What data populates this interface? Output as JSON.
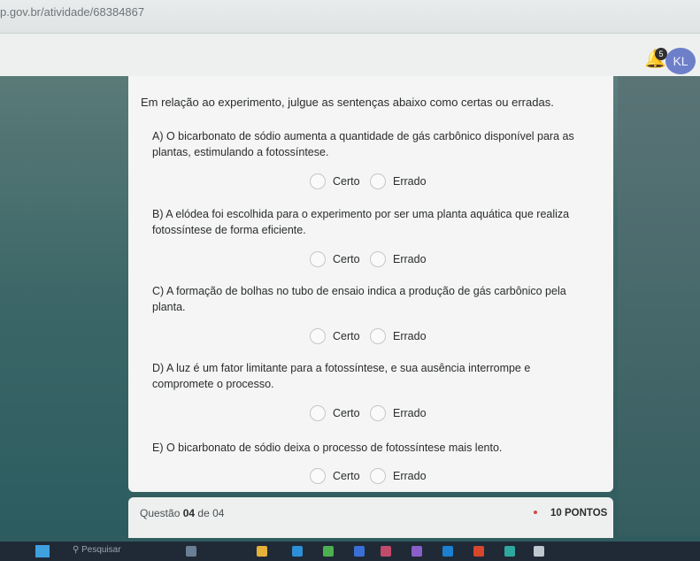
{
  "browser": {
    "url": "p.gov.br/atividade/68384867"
  },
  "header": {
    "notification_count": "5",
    "avatar_initials": "KL"
  },
  "question": {
    "intro": "Em relação ao experimento, julgue as sentenças abaixo como certas ou erradas.",
    "statements": [
      {
        "text": "A) O bicarbonato de sódio aumenta a quantidade de gás carbônico disponível para as plantas, estimulando a fotossíntese.",
        "option_true": "Certo",
        "option_false": "Errado"
      },
      {
        "text": "B) A elódea foi escolhida para o experimento por ser uma planta aquática que realiza fotossíntese de forma eficiente.",
        "option_true": "Certo",
        "option_false": "Errado"
      },
      {
        "text": "C) A formação de bolhas no tubo de ensaio indica a produção de gás carbônico pela planta.",
        "option_true": "Certo",
        "option_false": "Errado"
      },
      {
        "text": "D) A luz é um fator limitante para a fotossíntese, e sua ausência interrompe e compromete o processo.",
        "option_true": "Certo",
        "option_false": "Errado"
      },
      {
        "text": "E) O bicarbonato de sódio deixa o processo de fotossíntese mais lento.",
        "option_true": "Certo",
        "option_false": "Errado"
      }
    ]
  },
  "footer": {
    "label": "Questão",
    "number": "04",
    "of": "de 04",
    "points": "10 PONTOS"
  },
  "taskbar": {
    "search_placeholder": "Pesquisar"
  },
  "colors": {
    "brand": "#6d7fc9",
    "bell": "#2d3e8f",
    "required_dot": "#d04b4b"
  }
}
